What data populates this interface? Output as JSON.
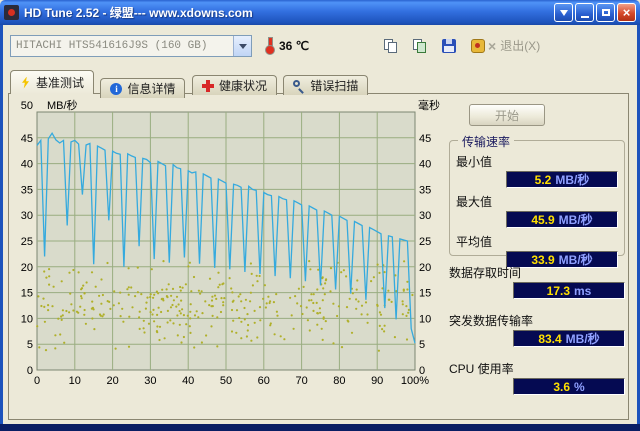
{
  "window": {
    "title": "HD Tune 2.52 - 绿盟--- www.xdowns.com"
  },
  "toolbar": {
    "drive_select": "HITACHI HTS541616J9S (160 GB)",
    "temperature": "36 ℃",
    "exit_label": "退出(X)"
  },
  "tabs": [
    {
      "label": "基准测试"
    },
    {
      "label": "信息详情"
    },
    {
      "label": "健康状况"
    },
    {
      "label": "错误扫描"
    }
  ],
  "benchmark": {
    "start_label": "开始",
    "transfer_rate": {
      "title": "传输速率",
      "items": [
        {
          "label": "最小值",
          "value": "5.2",
          "unit": "MB/秒"
        },
        {
          "label": "最大值",
          "value": "45.9",
          "unit": "MB/秒"
        },
        {
          "label": "平均值",
          "value": "33.9",
          "unit": "MB/秒"
        }
      ]
    },
    "stats": [
      {
        "label": "数据存取时间",
        "value": "17.3",
        "unit": "ms"
      },
      {
        "label": "突发数据传输率",
        "value": "83.4",
        "unit": "MB/秒"
      },
      {
        "label": "CPU 使用率",
        "value": "3.6",
        "unit": "%"
      }
    ]
  },
  "chart_data": {
    "type": "line",
    "y_left_label": "MB/秒",
    "y_right_label": "毫秒",
    "xlim": [
      0,
      100
    ],
    "ylim": [
      0,
      50
    ],
    "y_tick_step": 5,
    "grid": true,
    "x_ticks": [
      "0",
      "10",
      "20",
      "30",
      "40",
      "50",
      "60",
      "70",
      "80",
      "90",
      "100%"
    ],
    "series": [
      {
        "name": "transfer_rate_mb_s",
        "color": "#35aade",
        "x_step": 1,
        "values": [
          43.5,
          44.5,
          22,
          44.8,
          45.9,
          44.6,
          44,
          44.5,
          28,
          44.2,
          44.5,
          43.8,
          34,
          43.6,
          43.9,
          20.5,
          43.4,
          43,
          42.6,
          29,
          42.4,
          42,
          41.8,
          20,
          41.9,
          41.5,
          41.2,
          24,
          41,
          40.8,
          40.2,
          21.5,
          40.4,
          40,
          39.6,
          20.8,
          39.8,
          39.2,
          39,
          21.8,
          38.6,
          38.2,
          38.4,
          20.6,
          38,
          37.6,
          37.2,
          19.8,
          37,
          36.6,
          36.2,
          19.5,
          36,
          35.8,
          35.4,
          19,
          35.6,
          35,
          34.8,
          18.6,
          34.4,
          34,
          33.8,
          18.2,
          33.6,
          33.2,
          33,
          17.8,
          32.8,
          32.4,
          32,
          17.2,
          31.8,
          31.4,
          31,
          16.4,
          30.8,
          30.4,
          30,
          15.6,
          29.8,
          29.4,
          29,
          14.8,
          28.8,
          28.4,
          28,
          13.6,
          27.6,
          27.2,
          26.8,
          26.4,
          12,
          26,
          25.8,
          9.8,
          25.4,
          25.2,
          25,
          8,
          5.2
        ]
      }
    ],
    "scatter": {
      "name": "access_time_dots",
      "color": "#b0b02a",
      "count": 360,
      "seed": 987654321,
      "y_min": 3,
      "y_max": 22
    }
  }
}
